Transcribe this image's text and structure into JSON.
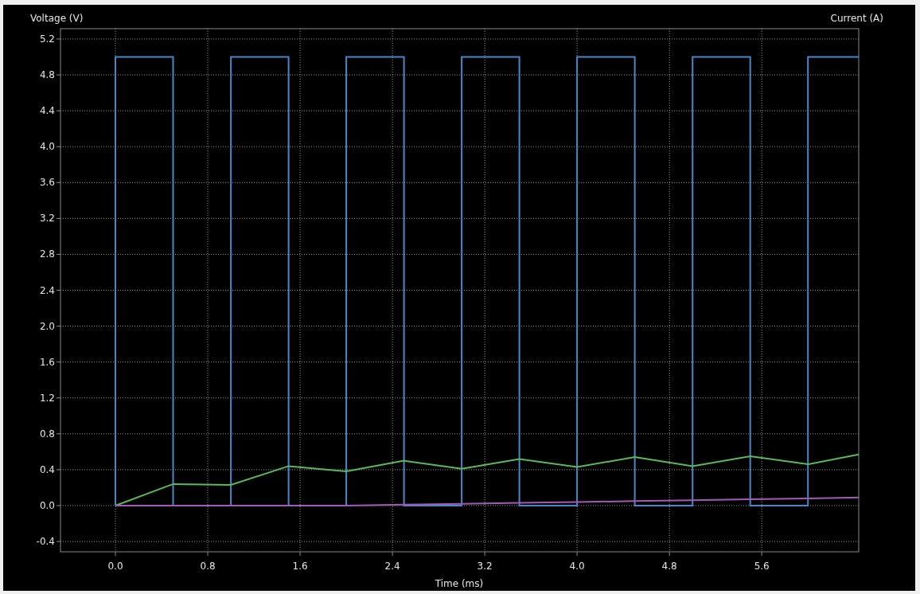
{
  "chart": {
    "right_axis_label": "Current (A)",
    "chart_data": {
      "type": "line",
      "grid": true,
      "xlabel": "Time (ms)",
      "ylabel": "Voltage (V)",
      "x": [
        0,
        0,
        0.5,
        0.5,
        1,
        1,
        1.5,
        1.5,
        2,
        2,
        2.5,
        2.5,
        3,
        3,
        3.5,
        3.5,
        4,
        4,
        4.5,
        4.5,
        5,
        5,
        5.5,
        5.5,
        6,
        6,
        6.44
      ],
      "series": [
        {
          "color": "#4a86c5",
          "values": [
            0,
            5,
            5,
            0,
            0,
            5,
            5,
            0,
            0,
            5,
            5,
            0,
            0,
            5,
            5,
            0,
            0,
            5,
            5,
            0,
            0,
            5,
            5,
            0,
            0,
            5,
            5
          ]
        },
        {
          "color": "#5cb85c",
          "values": [
            0,
            0,
            0.24,
            0.24,
            0.23,
            0.23,
            0.44,
            0.44,
            0.38,
            0.38,
            0.5,
            0.5,
            0.41,
            0.41,
            0.52,
            0.52,
            0.43,
            0.43,
            0.54,
            0.54,
            0.44,
            0.44,
            0.55,
            0.55,
            0.46,
            0.46,
            0.57
          ]
        },
        {
          "color": "#a05bb5",
          "values": [
            0,
            0,
            0,
            0,
            0,
            0,
            0,
            0,
            0,
            0,
            0.01,
            0.01,
            0.02,
            0.02,
            0.03,
            0.03,
            0.04,
            0.04,
            0.05,
            0.05,
            0.06,
            0.06,
            0.07,
            0.07,
            0.08,
            0.08,
            0.09
          ]
        }
      ],
      "xlim": [
        -0.476,
        6.44
      ],
      "ylim": [
        -0.515,
        5.315
      ],
      "xticks": [
        {
          "value": 0,
          "label": "0.0"
        },
        {
          "value": 0.8,
          "label": "0.8"
        },
        {
          "value": 1.6,
          "label": "1.6"
        },
        {
          "value": 2.4,
          "label": "2.4"
        },
        {
          "value": 3.2,
          "label": "3.2"
        },
        {
          "value": 4.0,
          "label": "4.0"
        },
        {
          "value": 4.8,
          "label": "4.8"
        },
        {
          "value": 5.6,
          "label": "5.6"
        }
      ],
      "yticks": [
        {
          "value": -0.4,
          "label": "-0.4"
        },
        {
          "value": 0,
          "label": "0.0"
        },
        {
          "value": 0.4,
          "label": "0.4"
        },
        {
          "value": 0.8,
          "label": "0.8"
        },
        {
          "value": 1.2,
          "label": "1.2"
        },
        {
          "value": 1.6,
          "label": "1.6"
        },
        {
          "value": 2.0,
          "label": "2.0"
        },
        {
          "value": 2.4,
          "label": "2.4"
        },
        {
          "value": 2.8,
          "label": "2.8"
        },
        {
          "value": 3.2,
          "label": "3.2"
        },
        {
          "value": 3.6,
          "label": "3.6"
        },
        {
          "value": 4.0,
          "label": "4.0"
        },
        {
          "value": 4.4,
          "label": "4.4"
        },
        {
          "value": 4.8,
          "label": "4.8"
        },
        {
          "value": 5.2,
          "label": "5.2"
        }
      ]
    }
  }
}
